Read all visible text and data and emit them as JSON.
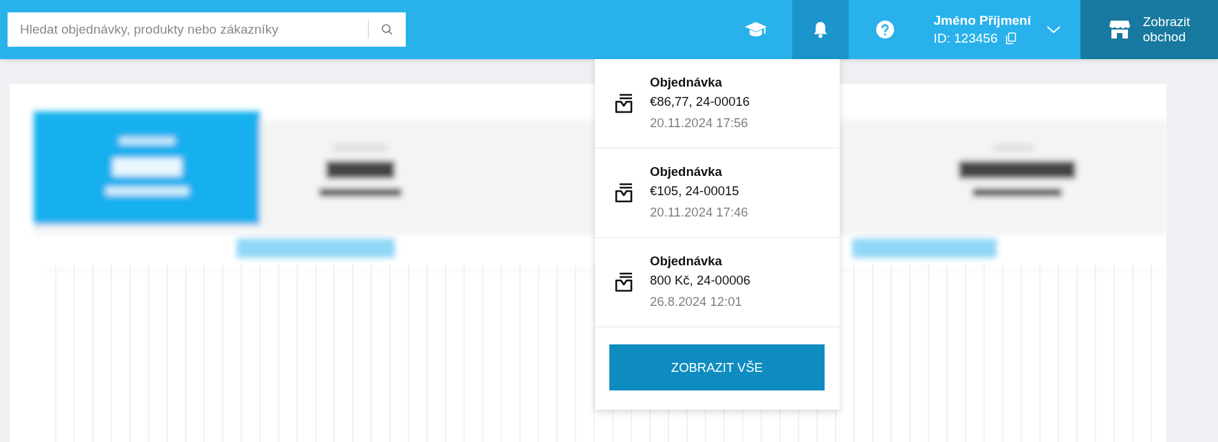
{
  "search": {
    "placeholder": "Hledat objednávky, produkty nebo zákazníky"
  },
  "header": {
    "notifications_open": true,
    "user": {
      "name": "Jméno Příjmení",
      "id": "ID: 123456"
    },
    "shop_button": [
      "Zobrazit",
      "obchod"
    ]
  },
  "notifications": [
    {
      "title": "Objednávka",
      "detail": "€86,77, 24-00016",
      "time": "20.11.2024 17:56"
    },
    {
      "title": "Objednávka",
      "detail": "€105, 24-00015",
      "time": "20.11.2024 17:46"
    },
    {
      "title": "Objednávka",
      "detail": "800 Kč, 24-00006",
      "time": "26.8.2024 12:01"
    }
  ],
  "show_all_button": "ZOBRAZIT VŠE"
}
